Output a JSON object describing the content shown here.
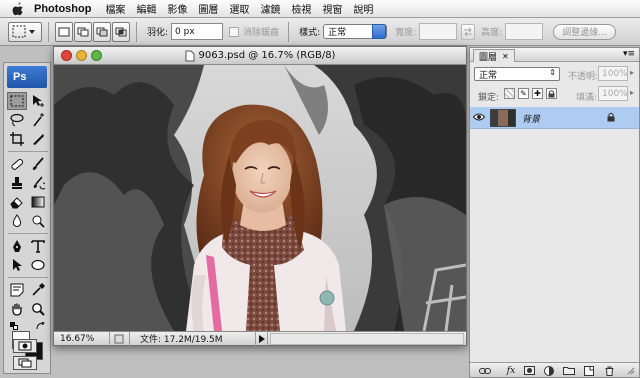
{
  "menubar": {
    "app_name": "Photoshop",
    "items": [
      "檔案",
      "編輯",
      "影像",
      "圖層",
      "選取",
      "濾鏡",
      "檢視",
      "視窗",
      "說明"
    ]
  },
  "options": {
    "feather_label": "羽化:",
    "feather_value": "0 px",
    "antialias_label": "消除鋸齒",
    "style_label": "樣式:",
    "style_value": "正常",
    "width_label": "寬度:",
    "height_label": "高度:",
    "refine_edge_label": "調整邊緣..."
  },
  "tools": {
    "logo": "Ps"
  },
  "document": {
    "title": "9063.psd @ 16.7% (RGB/8)",
    "zoom": "16.67%",
    "file_info": "文件: 17.2M/19.5M"
  },
  "layers_panel": {
    "tab": "圖層",
    "blend_mode": "正常",
    "opacity_label": "不透明:",
    "opacity_value": "100%",
    "lock_label": "鎖定:",
    "fill_label": "填滿:",
    "fill_value": "100%",
    "layer_name": "背景"
  },
  "colors": {
    "selected_layer": "#aecbf2",
    "style_select_arrow": "#2f6dcc",
    "close_button": "#e0463c",
    "minimize_button": "#e7b43a",
    "zoom_button": "#5fb548"
  }
}
